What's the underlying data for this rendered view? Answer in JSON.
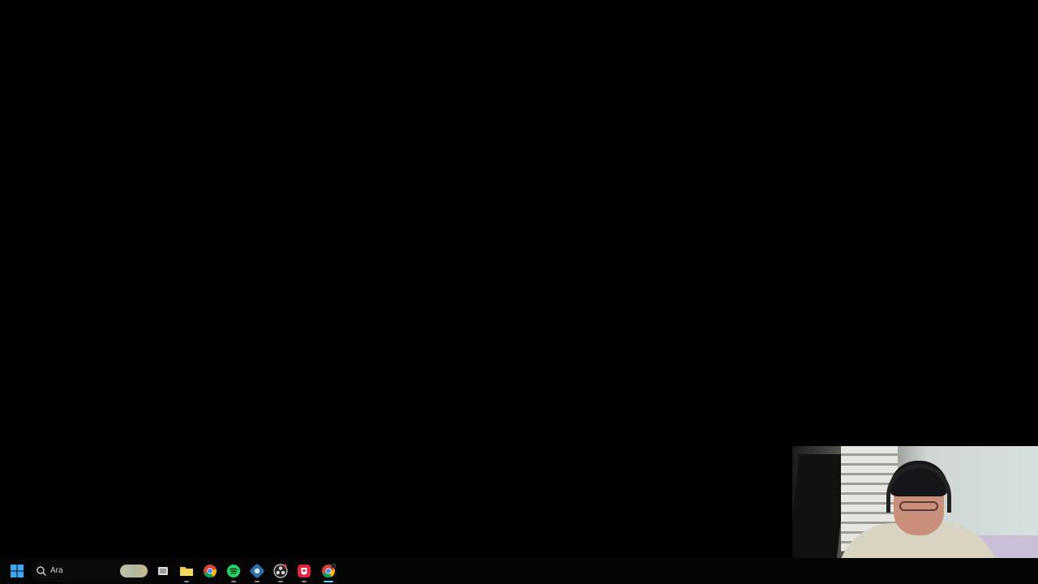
{
  "taskbar": {
    "search": {
      "label": "Ara",
      "icon": "search-icon"
    },
    "apps": [
      {
        "name": "task-view",
        "icon": "task-view-icon"
      },
      {
        "name": "file-explorer",
        "icon": "folder-icon"
      },
      {
        "name": "chrome",
        "icon": "chrome-icon"
      },
      {
        "name": "spotify",
        "icon": "spotify-icon"
      },
      {
        "name": "app-settings",
        "icon": "gear-app-icon"
      },
      {
        "name": "obs",
        "icon": "obs-icon"
      },
      {
        "name": "red-app",
        "icon": "red-app-icon"
      },
      {
        "name": "chrome-profile",
        "icon": "chrome-icon"
      }
    ]
  },
  "colors": {
    "desktop_bg": "#000000",
    "taskbar_bg": "#050505",
    "accent": "#60cdff"
  }
}
